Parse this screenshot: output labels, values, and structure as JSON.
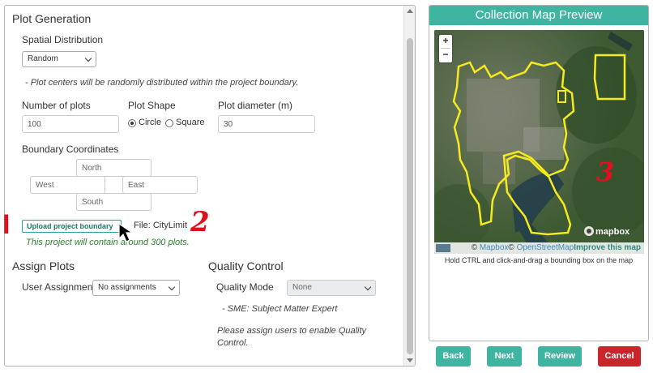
{
  "plot_generation": {
    "title": "Plot Generation",
    "spatial_distribution_label": "Spatial Distribution",
    "spatial_distribution_value": "Random",
    "spatial_note": "- Plot centers will be randomly distributed within the project boundary.",
    "num_plots_label": "Number of plots",
    "num_plots_value": "100",
    "plot_shape_label": "Plot Shape",
    "shape_circle": "Circle",
    "shape_square": "Square",
    "plot_diameter_label": "Plot diameter (m)",
    "plot_diameter_value": "30",
    "boundary_label": "Boundary Coordinates",
    "north_placeholder": "North",
    "west_placeholder": "West",
    "east_placeholder": "East",
    "south_placeholder": "South",
    "upload_button": "Upload project boundary",
    "file_text": "File: CityLimit",
    "plots_summary": "This project will contain around 300 plots."
  },
  "assign_plots": {
    "title": "Assign Plots",
    "user_assignment_label": "User Assignment",
    "user_assignment_value": "No assignments"
  },
  "quality_control": {
    "title": "Quality Control",
    "mode_label": "Quality Mode",
    "mode_value": "None",
    "sme_note": "- SME: Subject Matter Expert",
    "assign_note": "Please assign users to enable Quality Control."
  },
  "map": {
    "title": "Collection Map Preview",
    "zoom_in": "+",
    "zoom_out": "−",
    "logo_text": "mapbox",
    "attrib_copy": "©",
    "attrib_mapbox": "Mapbox",
    "attrib_osm": "OpenStreetMap",
    "attrib_improve": "Improve this map",
    "hint": "Hold CTRL and click-and-drag a bounding box on the map"
  },
  "buttons": {
    "back": "Back",
    "next": "Next",
    "review": "Review",
    "cancel": "Cancel"
  },
  "annotations": {
    "one": "I",
    "two": "2",
    "three": "3"
  },
  "colors": {
    "accent": "#3eb5a0",
    "cancel": "#c9262b",
    "annotation": "#e0101e",
    "boundary": "#f5ea1c"
  }
}
